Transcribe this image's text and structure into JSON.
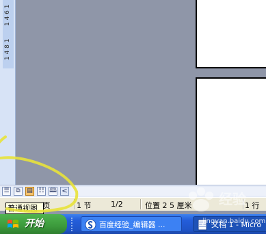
{
  "ruler": {
    "ticks": [
      "1 4 6 1",
      "1 4 8 1"
    ]
  },
  "view_buttons": [
    {
      "icon": "normal-view-icon",
      "glyph": "☰"
    },
    {
      "icon": "web-layout-icon",
      "glyph": "⧉"
    },
    {
      "icon": "print-layout-icon",
      "glyph": "▤"
    },
    {
      "icon": "outline-view-icon",
      "glyph": "☷"
    },
    {
      "icon": "reading-layout-icon",
      "glyph": "🕮"
    }
  ],
  "scroll_left_glyph": "<",
  "status": {
    "page": "1 页",
    "section": "1 节",
    "page_count": "1/2",
    "position": "位置 2 5 厘米",
    "line": "1 行"
  },
  "tooltip": "普通视图",
  "taskbar": {
    "start_label": "开始",
    "tasks": [
      {
        "label": "百度经验_编辑器 ...",
        "icon": "browser-icon"
      },
      {
        "label": "文档 1 - Micro",
        "icon": "word-document-icon"
      }
    ]
  },
  "watermark": "jingyan.baidu.com",
  "colors": {
    "highlight": "#e8e23a",
    "taskbar": "#245edb",
    "start": "#3c9a3c"
  }
}
